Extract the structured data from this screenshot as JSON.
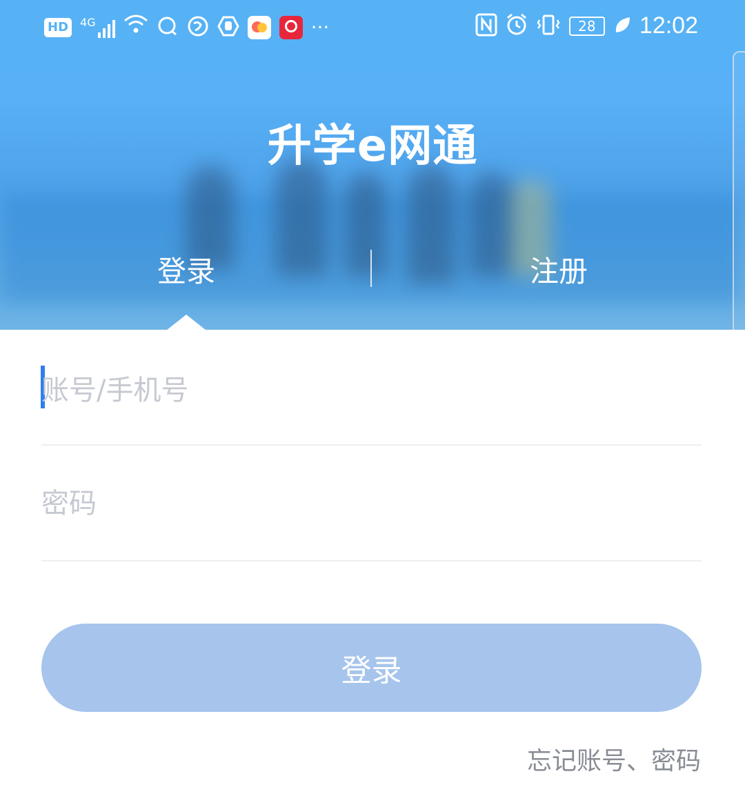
{
  "status_bar": {
    "hd_badge": "HD",
    "network": "4G",
    "battery_level": "28",
    "time": "12:02",
    "more": "···",
    "icons": [
      "signal-icon",
      "wifi-icon",
      "chat-bubble-icon",
      "vpn-icon",
      "hand-icon",
      "app-notification-icon",
      "video-app-icon",
      "nfc-icon",
      "alarm-icon",
      "vibrate-icon",
      "battery-icon",
      "leaf-icon"
    ]
  },
  "header": {
    "app_title": "升学e网通",
    "tabs": [
      {
        "label": "登录",
        "active": true
      },
      {
        "label": "注册",
        "active": false
      }
    ]
  },
  "form": {
    "account_placeholder": "账号/手机号",
    "account_value": "",
    "password_placeholder": "密码",
    "password_value": "",
    "login_button": "登录",
    "forgot_link": "忘记账号、密码"
  },
  "colors": {
    "header_blue": "#56b2f5",
    "button_disabled": "#a6c4ec",
    "caret_blue": "#2f7ef0",
    "placeholder_gray": "#c6c9d1",
    "link_gray": "#888c94"
  }
}
